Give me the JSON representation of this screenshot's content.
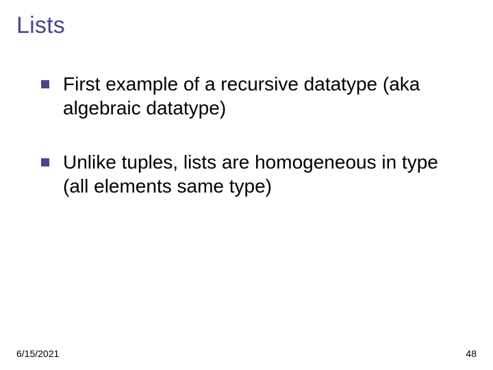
{
  "slide": {
    "title": "Lists",
    "bullets": [
      "First example of a recursive datatype (aka algebraic datatype)",
      "Unlike tuples, lists are homogeneous in type (all elements same type)"
    ],
    "footer": {
      "date": "6/15/2021",
      "page": "48"
    }
  }
}
